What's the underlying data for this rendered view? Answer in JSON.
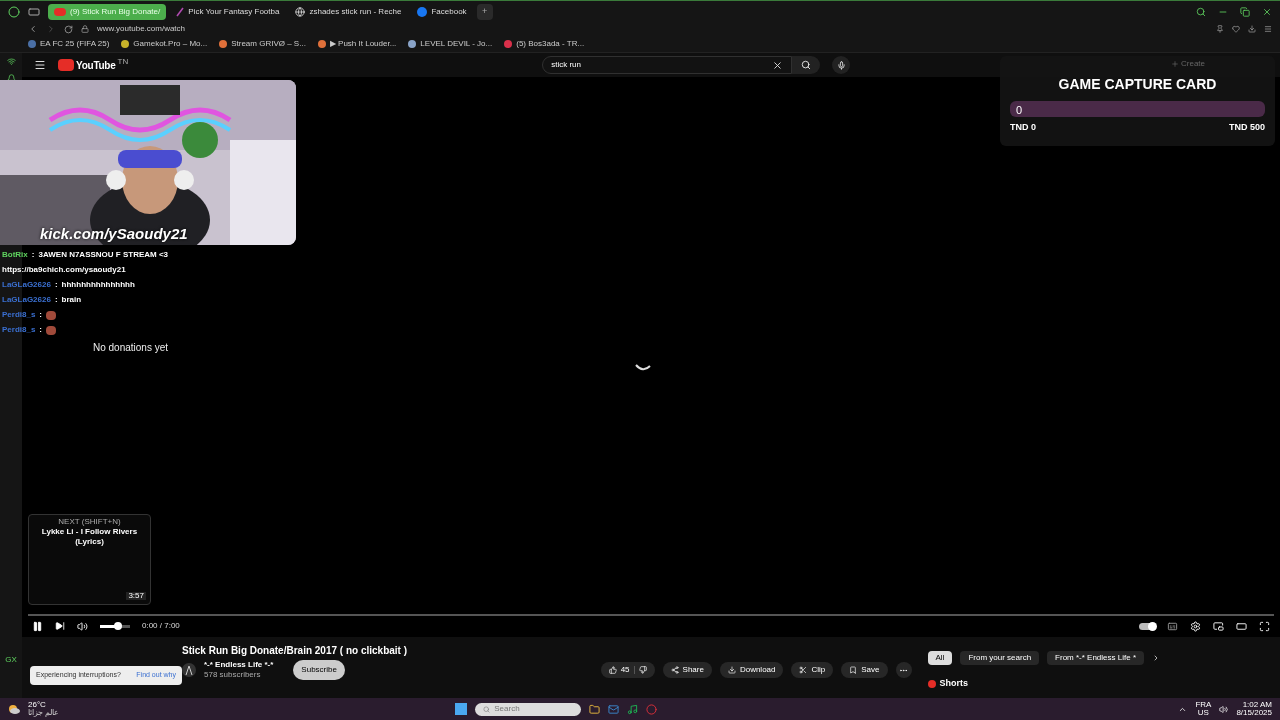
{
  "browser": {
    "tabs": [
      {
        "label": "(9) Stick Run Big Donate/",
        "selected": true,
        "kind": "youtube"
      },
      {
        "label": "Pick Your Fantasy Footba",
        "selected": false,
        "kind": "slash"
      },
      {
        "label": "zshades stick run - Reche",
        "selected": false,
        "kind": "google"
      },
      {
        "label": "Facebook",
        "selected": false,
        "kind": "facebook"
      }
    ],
    "new_tab": "+",
    "url": "www.youtube.com/watch",
    "bookmarks": [
      {
        "label": "EA FC 25 (FIFA 25)",
        "color": "#4a6fa5"
      },
      {
        "label": "Gamekot.Pro – Mo...",
        "color": "#c8b22a"
      },
      {
        "label": "Stream GRIVØ – S...",
        "color": "#e0703a"
      },
      {
        "label": "▶ Push It Louder...",
        "color": "#e0703a"
      },
      {
        "label": "LEVEL DEVIL - Jo...",
        "color": "#8aa4c8"
      },
      {
        "label": "(5) Bos3ada - TR...",
        "color": "#d9304a"
      }
    ]
  },
  "youtube": {
    "logo": "YouTube",
    "region": "TN",
    "search_value": "stick run",
    "create": "Create"
  },
  "overlay": {
    "webcam_caption": "kick.com/ySaoudy21",
    "chat": [
      {
        "kind": "message",
        "user": "BotRix",
        "separator": ":",
        "message": "3AWEN N7ASSNOU F STREAM <3",
        "color": "#5fd35f"
      },
      {
        "kind": "text",
        "message": "https://ba9chich.com/ysaoudy21",
        "color": "#ffffff"
      },
      {
        "kind": "message",
        "user": "LaGLaG2626",
        "separator": ":",
        "message": "hhhhhhhhhhhhhhh",
        "color": "#3a6fd0"
      },
      {
        "kind": "message",
        "user": "LaGLaG2626",
        "separator": ":",
        "message": "brain",
        "color": "#3a6fd0"
      },
      {
        "kind": "emote",
        "user": "Perdi8_s",
        "separator": ":",
        "color": "#3a6fd0"
      },
      {
        "kind": "emote",
        "user": "Perdi8_s",
        "separator": ":",
        "color": "#3a6fd0"
      }
    ],
    "donations": "No donations yet",
    "goal": {
      "title": "GAME CAPTURE CARD",
      "amount": "0",
      "level": 0,
      "min": "TND 0",
      "max": "TND 500"
    }
  },
  "player": {
    "next_label": "NEXT (SHIFT+N)",
    "next_title": "Lykke Li - I Follow Rivers (Lyrics)",
    "next_duration": "3:57",
    "progress": {
      "level": 0
    },
    "playing": true,
    "volume": {
      "level": 0.6
    },
    "time": "0:00 / 7:00",
    "autoplay": true
  },
  "video": {
    "title": "Stick Run Big Donate/Brain 2017 ( no clickbait )",
    "channel": "*-* Endless Life *-*",
    "subscribers": "578 subscribers",
    "subscribe": "Subscribe",
    "likes": "45",
    "actions": [
      "Share",
      "Download",
      "Clip",
      "Save"
    ]
  },
  "chips": [
    {
      "label": "All",
      "selected": true
    },
    {
      "label": "From your search",
      "selected": false
    },
    {
      "label": "From *-* Endless Life *",
      "selected": false
    }
  ],
  "shorts": "Shorts",
  "toast": {
    "message": "Experiencing interruptions?",
    "link": "Find out why"
  },
  "sidebar_label": "GX",
  "taskbar": {
    "temperature": "26°C",
    "weather_text": "عالم جزائا",
    "search_placeholder": "Search",
    "lang": "FRA",
    "region": "US",
    "time": "1:02 AM",
    "date": "8/15/2025"
  }
}
